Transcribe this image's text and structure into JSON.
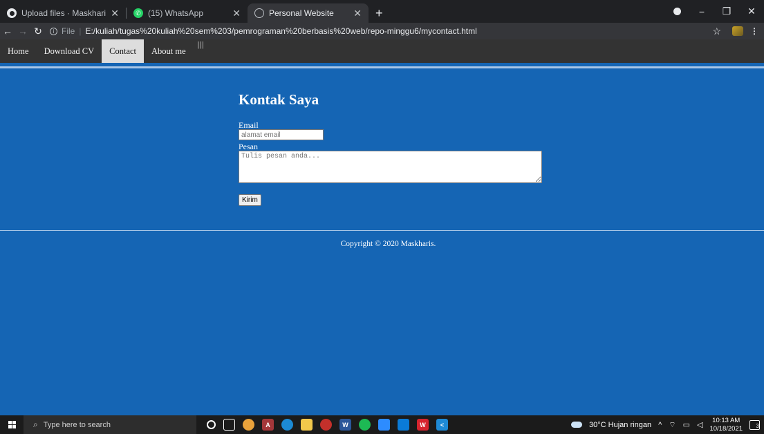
{
  "browser": {
    "tabs": [
      {
        "title": "Upload files · Maskharis/pemrog",
        "icon": "github-icon"
      },
      {
        "title": "(15) WhatsApp",
        "icon": "whatsapp-icon"
      },
      {
        "title": "Personal Website",
        "icon": "globe-icon",
        "active": true
      }
    ],
    "new_tab": "+",
    "scheme": "File",
    "url": "E:/kuliah/tugas%20kuliah%20sem%203/pemrograman%20berbasis%20web/repo-minggu6/mycontact.html"
  },
  "nav": {
    "items": [
      {
        "label": "Home"
      },
      {
        "label": "Download CV"
      },
      {
        "label": "Contact",
        "active": true
      },
      {
        "label": "About me"
      }
    ],
    "hamburger": "|||"
  },
  "contact": {
    "title": "Kontak Saya",
    "email_label": "Email",
    "email_placeholder": "alamat email",
    "message_label": "Pesan",
    "message_placeholder": "Tulis pesan anda...",
    "submit_label": "Kirim"
  },
  "footer": {
    "copyright": "Copyright © 2020 Maskharis."
  },
  "taskbar": {
    "search_placeholder": "Type here to search",
    "weather": "30°C  Hujan ringan",
    "time": "10:13 AM",
    "date": "10/18/2021",
    "notifications": "3"
  },
  "colors": {
    "page_bg": "#1565b4",
    "nav_bg": "#333333",
    "nav_active_bg": "#dddddd"
  }
}
